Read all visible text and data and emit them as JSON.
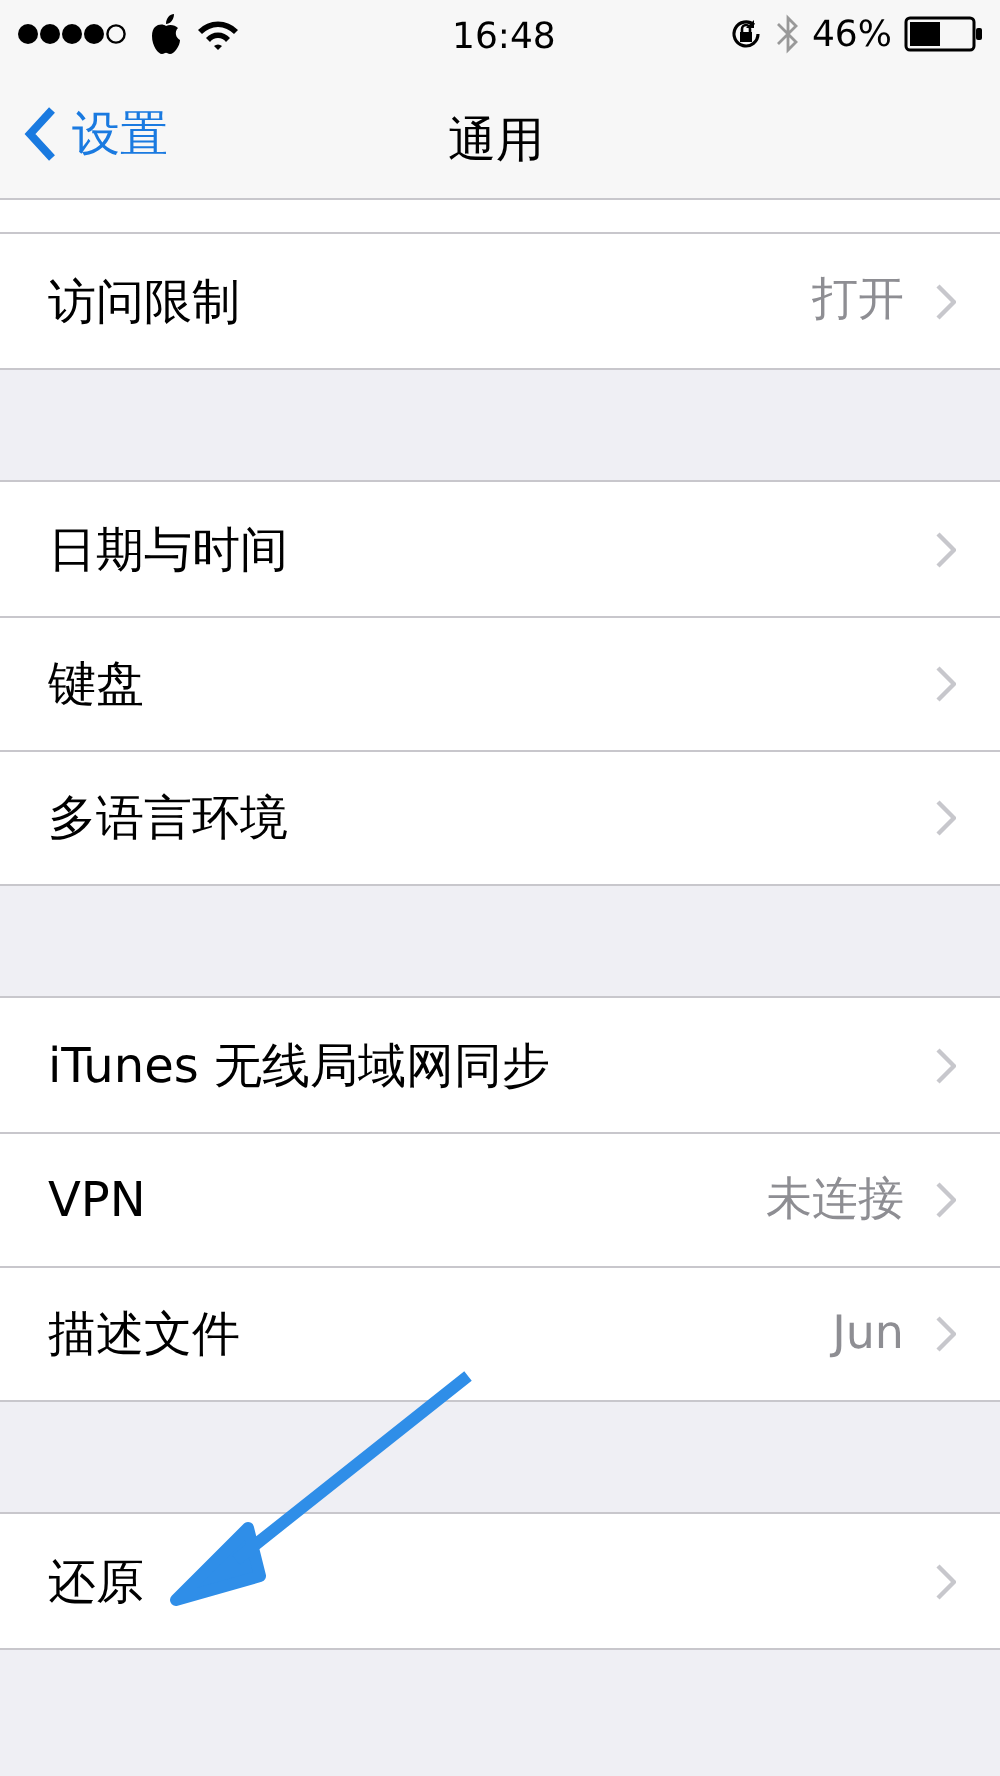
{
  "status_bar": {
    "time": "16:48",
    "battery": "46%"
  },
  "nav_bar": {
    "back": "设置",
    "title": "通用"
  },
  "groups": [
    {
      "rows": [
        {
          "label": "访问限制",
          "value": "打开"
        }
      ]
    },
    {
      "rows": [
        {
          "label": "日期与时间"
        },
        {
          "label": "键盘"
        },
        {
          "label": "多语言环境"
        }
      ]
    },
    {
      "rows": [
        {
          "label": "iTunes 无线局域网同步"
        },
        {
          "label": "VPN",
          "value": "未连接"
        },
        {
          "label": "描述文件",
          "value": "Jun"
        }
      ]
    },
    {
      "rows": [
        {
          "label": "还原"
        }
      ]
    }
  ]
}
